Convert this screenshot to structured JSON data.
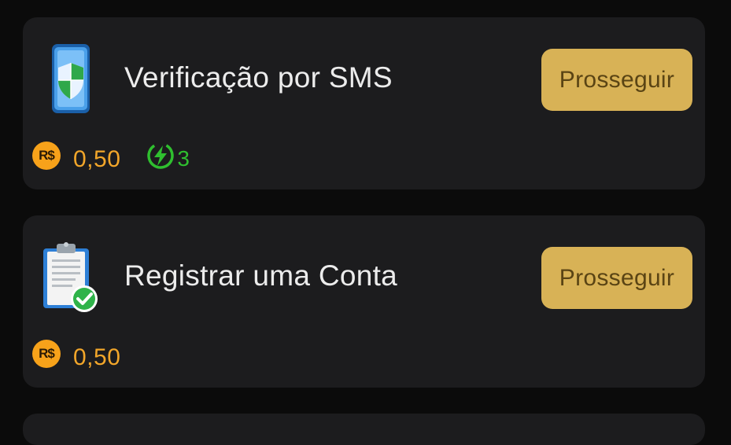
{
  "tasks": [
    {
      "title": "Verificação por SMS",
      "icon": "shield-phone-icon",
      "button_label": "Prosseguir",
      "currency_symbol": "R$",
      "reward": "0,50",
      "bonus_count": "3"
    },
    {
      "title": "Registrar uma Conta",
      "icon": "clipboard-check-icon",
      "button_label": "Prosseguir",
      "currency_symbol": "R$",
      "reward": "0,50"
    }
  ],
  "colors": {
    "background": "#0b0b0b",
    "card": "#1c1c1e",
    "button": "#d8b256",
    "button_text": "#5a4414",
    "reward": "#f2a62a",
    "coin": "#f7a21a",
    "bonus": "#2fbf2f"
  }
}
